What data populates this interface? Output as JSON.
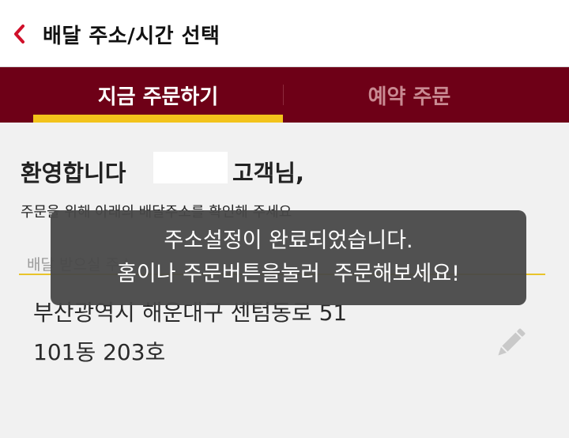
{
  "header": {
    "title": "배달 주소/시간 선택",
    "back_icon": "chevron-left-icon",
    "accent": "#d0102a"
  },
  "tabs": [
    {
      "label": "지금 주문하기",
      "active": true
    },
    {
      "label": "예약 주문",
      "active": false
    }
  ],
  "colors": {
    "tab_bar": "#6e0017",
    "indicator": "#f2c31b"
  },
  "welcome": {
    "greeting": "환영합니다",
    "customer_suffix": "고객님,"
  },
  "instruction": "주문을 위해 아래의 배달주소를 확인해 주세요",
  "address": {
    "label": "배달 받으실 주소",
    "line1": "부산광역시 해운대구 센텀동로 51",
    "line2": "101동 203호",
    "edit_icon": "pencil-icon"
  },
  "toast": {
    "line1": "주소설정이 완료되었습니다.",
    "line2": "홈이나 주문버튼을눌러  주문해보세요!"
  }
}
